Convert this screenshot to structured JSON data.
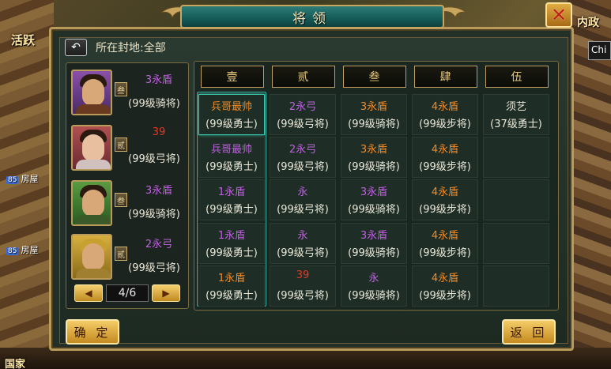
{
  "window": {
    "title": "将领"
  },
  "left_menu": {
    "huoyue": "活跃",
    "house_1": "房屋",
    "house_2": "房屋",
    "nation": "国家"
  },
  "right_menu": {
    "neizheng": "内政",
    "chat_preview": "Chi"
  },
  "filter": {
    "label": "所在封地:全部"
  },
  "generals": [
    {
      "troop": "3永盾",
      "troop_color": "purple",
      "level": "(99级骑将)",
      "rank": "叁",
      "portrait": "general-portrait-1"
    },
    {
      "troop": "39",
      "troop_color": "red",
      "level": "(99级弓将)",
      "rank": "贰",
      "portrait": "general-portrait-2"
    },
    {
      "troop": "3永盾",
      "troop_color": "purple",
      "level": "(99级骑将)",
      "rank": "叁",
      "portrait": "general-portrait-3"
    },
    {
      "troop": "2永弓",
      "troop_color": "purple",
      "level": "(99级弓将)",
      "rank": "贰",
      "portrait": "general-portrait-4"
    }
  ],
  "pager": {
    "page": "4/6",
    "prev_icon": "left-arrow-icon",
    "next_icon": "right-arrow-icon"
  },
  "columns": [
    "壹",
    "贰",
    "叁",
    "肆",
    "伍"
  ],
  "rows": [
    [
      {
        "t": "兵哥最帅",
        "c": "orange",
        "l": "(99级勇士)"
      },
      {
        "t": "2永弓",
        "c": "purple",
        "l": "(99级弓将)"
      },
      {
        "t": "3永盾",
        "c": "orange",
        "l": "(99级骑将)"
      },
      {
        "t": "4永盾",
        "c": "orange",
        "l": "(99级步将)"
      },
      {
        "t": "须艺",
        "c": "light",
        "l": "(37级勇士)"
      }
    ],
    [
      {
        "t": "兵哥最帅",
        "c": "purple",
        "l": "(99级勇士)"
      },
      {
        "t": "2永弓",
        "c": "purple",
        "l": "(99级弓将)"
      },
      {
        "t": "3永盾",
        "c": "orange",
        "l": "(99级骑将)"
      },
      {
        "t": "4永盾",
        "c": "orange",
        "l": "(99级步将)"
      },
      {
        "t": "",
        "c": "light",
        "l": ""
      }
    ],
    [
      {
        "t": "1永盾",
        "c": "purple",
        "l": "(99级勇士)"
      },
      {
        "t": "永",
        "c": "purple",
        "l": "(99级弓将)"
      },
      {
        "t": "3永盾",
        "c": "purple",
        "l": "(99级骑将)"
      },
      {
        "t": "4永盾",
        "c": "orange",
        "l": "(99级步将)"
      },
      {
        "t": "",
        "c": "light",
        "l": ""
      }
    ],
    [
      {
        "t": "1永盾",
        "c": "purple",
        "l": "(99级勇士)"
      },
      {
        "t": "永",
        "c": "purple",
        "l": "(99级弓将)"
      },
      {
        "t": "3永盾",
        "c": "purple",
        "l": "(99级骑将)"
      },
      {
        "t": "4永盾",
        "c": "orange",
        "l": "(99级步将)"
      },
      {
        "t": "",
        "c": "light",
        "l": ""
      }
    ],
    [
      {
        "t": "1永盾",
        "c": "orange",
        "l": "(99级勇士)"
      },
      {
        "t": "39",
        "c": "red",
        "l": "(99级弓将)"
      },
      {
        "t": "永",
        "c": "purple",
        "l": "(99级骑将)"
      },
      {
        "t": "4永盾",
        "c": "orange",
        "l": "(99级步将)"
      },
      {
        "t": "",
        "c": "light",
        "l": ""
      }
    ]
  ],
  "footer": {
    "confirm": "确 定",
    "back": "返 回"
  },
  "colors": {
    "purple": "#c060e0",
    "orange": "#f08a28",
    "red": "#e03a2a",
    "light": "#ece8d8",
    "frame_gold": "#b89a5a",
    "title_teal": "#145a56"
  }
}
